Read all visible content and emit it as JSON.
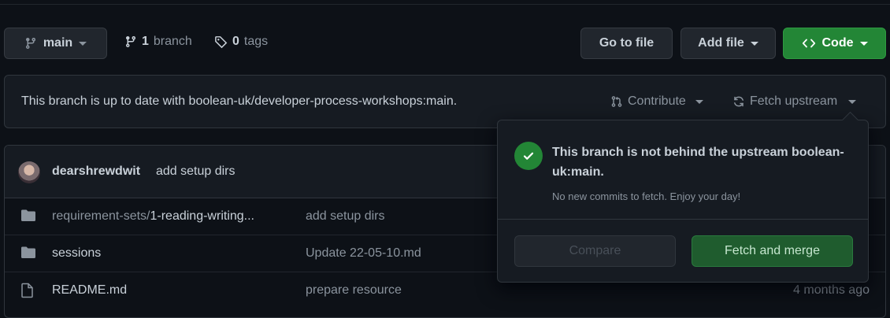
{
  "toolbar": {
    "branch_label": "main",
    "branch_count": "1",
    "branch_word": "branch",
    "tag_count": "0",
    "tag_word": "tags",
    "go_to_file": "Go to file",
    "add_file": "Add file",
    "code": "Code"
  },
  "banner": {
    "text": "This branch is up to date with boolean-uk/developer-process-workshops:main.",
    "contribute": "Contribute",
    "fetch_upstream": "Fetch upstream"
  },
  "commit": {
    "author": "dearshrewdwit",
    "message": "add setup dirs"
  },
  "files": [
    {
      "type": "folder",
      "prefix": "requirement-sets/",
      "name": "1-reading-writing...",
      "message": "add setup dirs",
      "age": ""
    },
    {
      "type": "folder",
      "prefix": "",
      "name": "sessions",
      "message": "Update 22-05-10.md",
      "age": ""
    },
    {
      "type": "file",
      "prefix": "",
      "name": "README.md",
      "message": "prepare resource",
      "age": "4 months ago"
    }
  ],
  "popover": {
    "title": "This branch is not behind the upstream boolean-uk:main.",
    "subtitle": "No new commits to fetch. Enjoy your day!",
    "compare": "Compare",
    "fetch_and_merge": "Fetch and merge"
  },
  "colors": {
    "background": "#0d1117",
    "code_button": "#238636",
    "success": "#238636",
    "muted_text": "#8b949e"
  }
}
